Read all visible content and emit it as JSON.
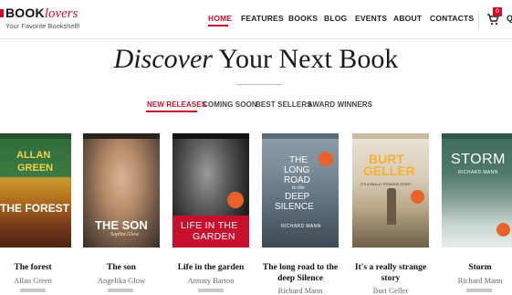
{
  "header": {
    "logo_part1": "BOOK",
    "logo_part2": "lovers",
    "tagline": "Your Favorite Bookshelf!",
    "cart_count": "0",
    "search_fragment": "Q"
  },
  "nav": {
    "items": [
      "HOME",
      "FEATURES",
      "BOOKS",
      "BLOG",
      "EVENTS",
      "ABOUT",
      "CONTACTS"
    ],
    "active": "HOME"
  },
  "hero": {
    "title_em": "Discover",
    "title_rest": "Your Next Book"
  },
  "tabs": {
    "items": [
      "NEW RELEASES",
      "COMING SOON",
      "BEST SELLERS",
      "AWARD WINNERS"
    ],
    "active": "NEW RELEASES"
  },
  "books": [
    {
      "title": "The forest",
      "author": "Allan Green",
      "cover_lines": [
        "ALLAN",
        "GREEN",
        "THE FOREST"
      ],
      "colors": {
        "top": "#2e6b3a",
        "mid": "#c99a2e",
        "bottom": "#7a3b1c"
      }
    },
    {
      "title": "The son",
      "author": "Angelika Glow",
      "cover_lines": [
        "THE SON",
        "Sophia Glow"
      ],
      "colors": {
        "top": "#6b5443",
        "mid": "#c9a583",
        "bottom": "#3a2c24"
      }
    },
    {
      "title": "Life in the garden",
      "author": "Antony Barton",
      "cover_lines": [
        "LIFE IN THE",
        "GARDEN"
      ],
      "colors": {
        "top": "#1e1e1e",
        "mid": "#777777",
        "bottom": "#c8102e"
      }
    },
    {
      "title": "The long road to the deep Silence",
      "author": "Richard Mann",
      "cover_lines": [
        "THE",
        "LONG",
        "ROAD",
        "to the",
        "DEEP",
        "SILENCE",
        "RICHARD MANN"
      ],
      "colors": {
        "top": "#7d8d9a",
        "mid": "#5c6c78",
        "bottom": "#3f4a53"
      }
    },
    {
      "title": "It's a really strange story",
      "author": "Burt Geller",
      "cover_lines": [
        "BURT",
        "GELLER",
        "IT'S A REALLY STRANGE STORY"
      ],
      "colors": {
        "top": "#e8e0d2",
        "mid": "#b8a887",
        "bottom": "#6d5f48"
      }
    },
    {
      "title": "Storm",
      "author": "Richard Mann",
      "cover_lines": [
        "STORM",
        "RICHARD MANN"
      ],
      "colors": {
        "top": "#3d6b5c",
        "mid": "#8aa39a",
        "bottom": "#e5ecea"
      }
    }
  ],
  "accent": "#c8102e"
}
